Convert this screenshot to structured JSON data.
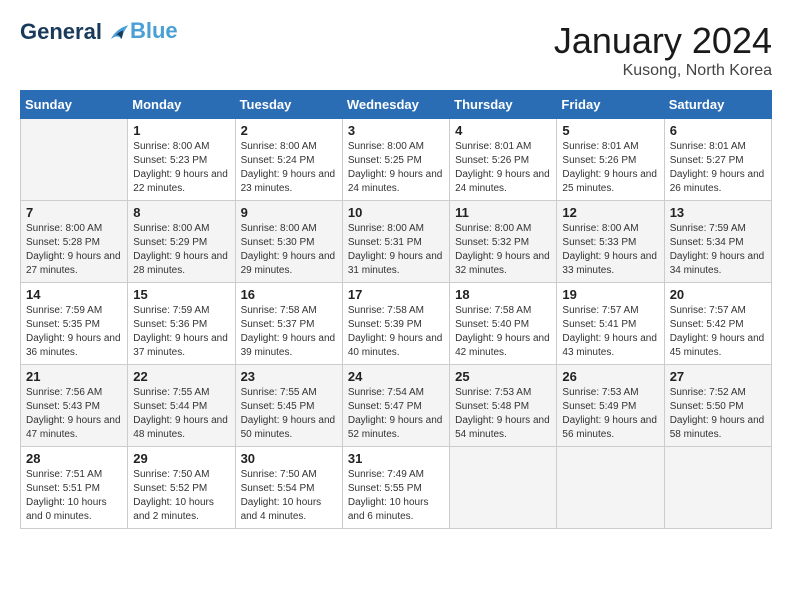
{
  "header": {
    "logo_line1": "General",
    "logo_line2": "Blue",
    "month": "January 2024",
    "location": "Kusong, North Korea"
  },
  "days_of_week": [
    "Sunday",
    "Monday",
    "Tuesday",
    "Wednesday",
    "Thursday",
    "Friday",
    "Saturday"
  ],
  "weeks": [
    [
      {
        "day": "",
        "sunrise": "",
        "sunset": "",
        "daylight": ""
      },
      {
        "day": "1",
        "sunrise": "Sunrise: 8:00 AM",
        "sunset": "Sunset: 5:23 PM",
        "daylight": "Daylight: 9 hours and 22 minutes."
      },
      {
        "day": "2",
        "sunrise": "Sunrise: 8:00 AM",
        "sunset": "Sunset: 5:24 PM",
        "daylight": "Daylight: 9 hours and 23 minutes."
      },
      {
        "day": "3",
        "sunrise": "Sunrise: 8:00 AM",
        "sunset": "Sunset: 5:25 PM",
        "daylight": "Daylight: 9 hours and 24 minutes."
      },
      {
        "day": "4",
        "sunrise": "Sunrise: 8:01 AM",
        "sunset": "Sunset: 5:26 PM",
        "daylight": "Daylight: 9 hours and 24 minutes."
      },
      {
        "day": "5",
        "sunrise": "Sunrise: 8:01 AM",
        "sunset": "Sunset: 5:26 PM",
        "daylight": "Daylight: 9 hours and 25 minutes."
      },
      {
        "day": "6",
        "sunrise": "Sunrise: 8:01 AM",
        "sunset": "Sunset: 5:27 PM",
        "daylight": "Daylight: 9 hours and 26 minutes."
      }
    ],
    [
      {
        "day": "7",
        "sunrise": "Sunrise: 8:00 AM",
        "sunset": "Sunset: 5:28 PM",
        "daylight": "Daylight: 9 hours and 27 minutes."
      },
      {
        "day": "8",
        "sunrise": "Sunrise: 8:00 AM",
        "sunset": "Sunset: 5:29 PM",
        "daylight": "Daylight: 9 hours and 28 minutes."
      },
      {
        "day": "9",
        "sunrise": "Sunrise: 8:00 AM",
        "sunset": "Sunset: 5:30 PM",
        "daylight": "Daylight: 9 hours and 29 minutes."
      },
      {
        "day": "10",
        "sunrise": "Sunrise: 8:00 AM",
        "sunset": "Sunset: 5:31 PM",
        "daylight": "Daylight: 9 hours and 31 minutes."
      },
      {
        "day": "11",
        "sunrise": "Sunrise: 8:00 AM",
        "sunset": "Sunset: 5:32 PM",
        "daylight": "Daylight: 9 hours and 32 minutes."
      },
      {
        "day": "12",
        "sunrise": "Sunrise: 8:00 AM",
        "sunset": "Sunset: 5:33 PM",
        "daylight": "Daylight: 9 hours and 33 minutes."
      },
      {
        "day": "13",
        "sunrise": "Sunrise: 7:59 AM",
        "sunset": "Sunset: 5:34 PM",
        "daylight": "Daylight: 9 hours and 34 minutes."
      }
    ],
    [
      {
        "day": "14",
        "sunrise": "Sunrise: 7:59 AM",
        "sunset": "Sunset: 5:35 PM",
        "daylight": "Daylight: 9 hours and 36 minutes."
      },
      {
        "day": "15",
        "sunrise": "Sunrise: 7:59 AM",
        "sunset": "Sunset: 5:36 PM",
        "daylight": "Daylight: 9 hours and 37 minutes."
      },
      {
        "day": "16",
        "sunrise": "Sunrise: 7:58 AM",
        "sunset": "Sunset: 5:37 PM",
        "daylight": "Daylight: 9 hours and 39 minutes."
      },
      {
        "day": "17",
        "sunrise": "Sunrise: 7:58 AM",
        "sunset": "Sunset: 5:39 PM",
        "daylight": "Daylight: 9 hours and 40 minutes."
      },
      {
        "day": "18",
        "sunrise": "Sunrise: 7:58 AM",
        "sunset": "Sunset: 5:40 PM",
        "daylight": "Daylight: 9 hours and 42 minutes."
      },
      {
        "day": "19",
        "sunrise": "Sunrise: 7:57 AM",
        "sunset": "Sunset: 5:41 PM",
        "daylight": "Daylight: 9 hours and 43 minutes."
      },
      {
        "day": "20",
        "sunrise": "Sunrise: 7:57 AM",
        "sunset": "Sunset: 5:42 PM",
        "daylight": "Daylight: 9 hours and 45 minutes."
      }
    ],
    [
      {
        "day": "21",
        "sunrise": "Sunrise: 7:56 AM",
        "sunset": "Sunset: 5:43 PM",
        "daylight": "Daylight: 9 hours and 47 minutes."
      },
      {
        "day": "22",
        "sunrise": "Sunrise: 7:55 AM",
        "sunset": "Sunset: 5:44 PM",
        "daylight": "Daylight: 9 hours and 48 minutes."
      },
      {
        "day": "23",
        "sunrise": "Sunrise: 7:55 AM",
        "sunset": "Sunset: 5:45 PM",
        "daylight": "Daylight: 9 hours and 50 minutes."
      },
      {
        "day": "24",
        "sunrise": "Sunrise: 7:54 AM",
        "sunset": "Sunset: 5:47 PM",
        "daylight": "Daylight: 9 hours and 52 minutes."
      },
      {
        "day": "25",
        "sunrise": "Sunrise: 7:53 AM",
        "sunset": "Sunset: 5:48 PM",
        "daylight": "Daylight: 9 hours and 54 minutes."
      },
      {
        "day": "26",
        "sunrise": "Sunrise: 7:53 AM",
        "sunset": "Sunset: 5:49 PM",
        "daylight": "Daylight: 9 hours and 56 minutes."
      },
      {
        "day": "27",
        "sunrise": "Sunrise: 7:52 AM",
        "sunset": "Sunset: 5:50 PM",
        "daylight": "Daylight: 9 hours and 58 minutes."
      }
    ],
    [
      {
        "day": "28",
        "sunrise": "Sunrise: 7:51 AM",
        "sunset": "Sunset: 5:51 PM",
        "daylight": "Daylight: 10 hours and 0 minutes."
      },
      {
        "day": "29",
        "sunrise": "Sunrise: 7:50 AM",
        "sunset": "Sunset: 5:52 PM",
        "daylight": "Daylight: 10 hours and 2 minutes."
      },
      {
        "day": "30",
        "sunrise": "Sunrise: 7:50 AM",
        "sunset": "Sunset: 5:54 PM",
        "daylight": "Daylight: 10 hours and 4 minutes."
      },
      {
        "day": "31",
        "sunrise": "Sunrise: 7:49 AM",
        "sunset": "Sunset: 5:55 PM",
        "daylight": "Daylight: 10 hours and 6 minutes."
      },
      {
        "day": "",
        "sunrise": "",
        "sunset": "",
        "daylight": ""
      },
      {
        "day": "",
        "sunrise": "",
        "sunset": "",
        "daylight": ""
      },
      {
        "day": "",
        "sunrise": "",
        "sunset": "",
        "daylight": ""
      }
    ]
  ]
}
